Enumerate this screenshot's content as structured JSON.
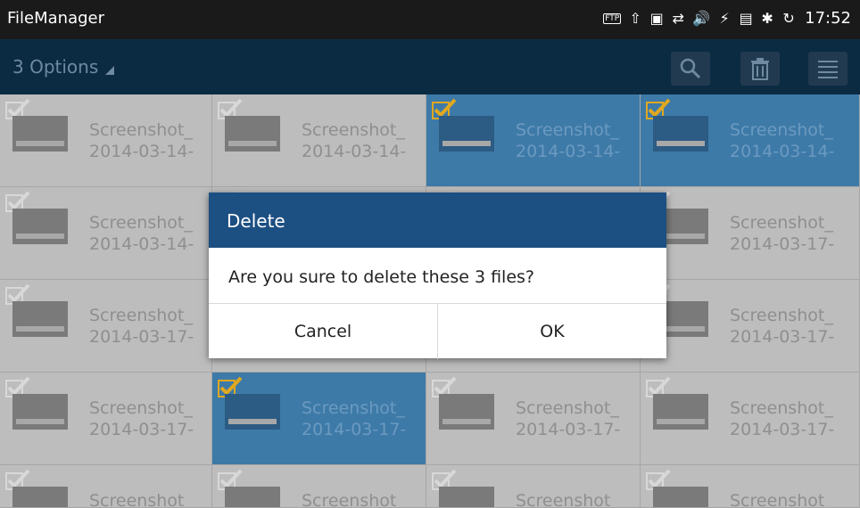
{
  "status_bar": {
    "app_title": "FileManager",
    "icons": [
      "ftp-icon",
      "upload-icon",
      "image-icon",
      "sync-icon",
      "volume-icon",
      "usb-icon",
      "sim-icon",
      "bluetooth-icon",
      "refresh-icon"
    ],
    "ftp_label": "FTP",
    "time": "17:52"
  },
  "action_bar": {
    "options_label": "3 Options",
    "buttons": [
      "search-icon",
      "trash-icon",
      "menu-icon"
    ],
    "accent": "#0b2b43"
  },
  "grid": {
    "selected_color": "#3e7aa8",
    "rows": [
      [
        {
          "line1": "Screenshot_",
          "line2": "2014-03-14-",
          "selected": false
        },
        {
          "line1": "Screenshot_",
          "line2": "2014-03-14-",
          "selected": false
        },
        {
          "line1": "Screenshot_",
          "line2": "2014-03-14-",
          "selected": true
        },
        {
          "line1": "Screenshot_",
          "line2": "2014-03-14-",
          "selected": true
        }
      ],
      [
        {
          "line1": "Screenshot_",
          "line2": "2014-03-14-",
          "selected": false
        },
        {
          "line1": "",
          "line2": "",
          "selected": false
        },
        {
          "line1": "",
          "line2": "",
          "selected": false
        },
        {
          "line1": "Screenshot_",
          "line2": "2014-03-17-",
          "selected": false
        }
      ],
      [
        {
          "line1": "Screenshot_",
          "line2": "2014-03-17-",
          "selected": false
        },
        {
          "line1": "",
          "line2": "",
          "selected": false
        },
        {
          "line1": "",
          "line2": "",
          "selected": false
        },
        {
          "line1": "Screenshot_",
          "line2": "2014-03-17-",
          "selected": false
        }
      ],
      [
        {
          "line1": "Screenshot_",
          "line2": "2014-03-17-",
          "selected": false
        },
        {
          "line1": "Screenshot_",
          "line2": "2014-03-17-",
          "selected": true
        },
        {
          "line1": "Screenshot_",
          "line2": "2014-03-17-",
          "selected": false
        },
        {
          "line1": "Screenshot_",
          "line2": "2014-03-17-",
          "selected": false
        }
      ],
      [
        {
          "line1": "Screenshot",
          "line2": "",
          "selected": false
        },
        {
          "line1": "Screenshot",
          "line2": "",
          "selected": false
        },
        {
          "line1": "Screenshot",
          "line2": "",
          "selected": false
        },
        {
          "line1": "Screenshot",
          "line2": "",
          "selected": false
        }
      ]
    ]
  },
  "dialog": {
    "title": "Delete",
    "message": "Are you sure to delete these  3 files?",
    "cancel_label": "Cancel",
    "ok_label": "OK",
    "title_color": "#1c4f82"
  }
}
